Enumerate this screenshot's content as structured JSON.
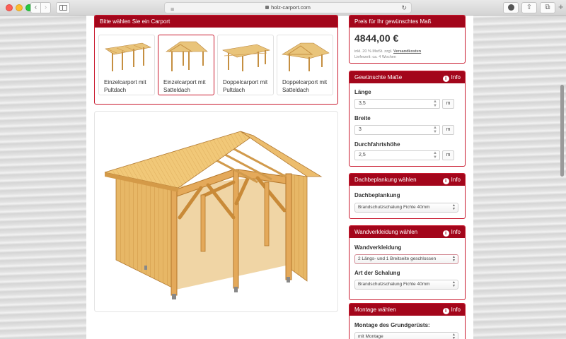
{
  "browser": {
    "url": "holz-carport.com"
  },
  "carport_select": {
    "title": "Bitte wählen Sie ein Carport",
    "cards": [
      {
        "line1": "Einzelcarport mit",
        "line2": "Pultdach"
      },
      {
        "line1": "Einzelcarport mit",
        "line2": "Satteldach"
      },
      {
        "line1": "Doppelcarport mit",
        "line2": "Pultdach"
      },
      {
        "line1": "Doppelcarport mit",
        "line2": "Satteldach"
      }
    ]
  },
  "price": {
    "title": "Preis für Ihr gewünschtes Maß",
    "amount": "4844,00 €",
    "vat_text": "inkl. 20 % MwSt. zzgl.",
    "shipping_link": "Versandkosten",
    "delivery": "Lieferzeit: ca. 4 Wochen"
  },
  "dimensions": {
    "title": "Gewünschte Maße",
    "info_label": "Info",
    "fields": [
      {
        "label": "Länge",
        "value": "3,5",
        "unit": "m"
      },
      {
        "label": "Breite",
        "value": "3",
        "unit": "m"
      },
      {
        "label": "Durchfahrtshöhe",
        "value": "2,5",
        "unit": "m"
      }
    ]
  },
  "roof": {
    "title": "Dachbeplankung wählen",
    "info_label": "Info",
    "field_label": "Dachbeplankung",
    "selected": "Brandschutzschalung Fichte 40mm"
  },
  "wall": {
    "title": "Wandverkleidung wählen",
    "info_label": "Info",
    "field_label": "Wandverkleidung",
    "selected": "2 Längs- und 1 Breitseite geschlossen",
    "field2_label": "Art der Schalung",
    "selected2": "Brandschutzschalung Fichte 40mm"
  },
  "mounting": {
    "title": "Montage wählen",
    "info_label": "Info",
    "field_label": "Montage des Grundgerüsts:",
    "selected": "mit Montage"
  }
}
